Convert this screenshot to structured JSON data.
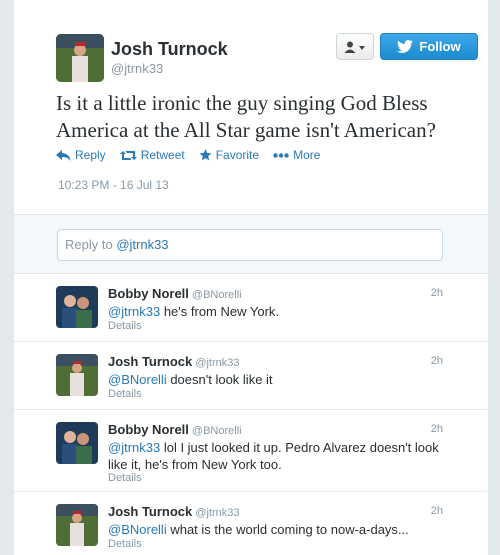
{
  "tweet": {
    "author_name": "Josh Turnock",
    "author_handle": "@jtrnk33",
    "follow_label": "Follow",
    "text": "Is it a little ironic the guy singing God Bless America at the All Star game isn't American?",
    "actions": {
      "reply": "Reply",
      "retweet": "Retweet",
      "favorite": "Favorite",
      "more": "More"
    },
    "timestamp": "10:23 PM - 16 Jul 13"
  },
  "reply_box": {
    "prefix": "Reply to ",
    "mention": "@jtrnk33"
  },
  "replies": [
    {
      "name": "Bobby Norell",
      "handle": "@BNorelli",
      "time": "2h",
      "mention": "@jtrnk33",
      "text": " he's from New York.",
      "details": "Details"
    },
    {
      "name": "Josh Turnock",
      "handle": "@jtrnk33",
      "time": "2h",
      "mention": "@BNorelli",
      "text": " doesn't look like it",
      "details": "Details"
    },
    {
      "name": "Bobby Norell",
      "handle": "@BNorelli",
      "time": "2h",
      "mention": "@jtrnk33",
      "text": " lol I just looked it up. Pedro Alvarez doesn't look like it, he's from New York too.",
      "details": "Details"
    },
    {
      "name": "Josh Turnock",
      "handle": "@jtrnk33",
      "time": "2h",
      "mention": "@BNorelli",
      "text": " what is the world coming to now-a-days...",
      "details": "Details"
    }
  ],
  "colors": {
    "link": "#2a7ab8",
    "follow_button": "#2a9bdc",
    "muted": "#8899a6"
  },
  "icons": [
    "user-menu-icon",
    "twitter-bird-icon",
    "reply-icon",
    "retweet-icon",
    "favorite-star-icon",
    "more-dots-icon"
  ]
}
